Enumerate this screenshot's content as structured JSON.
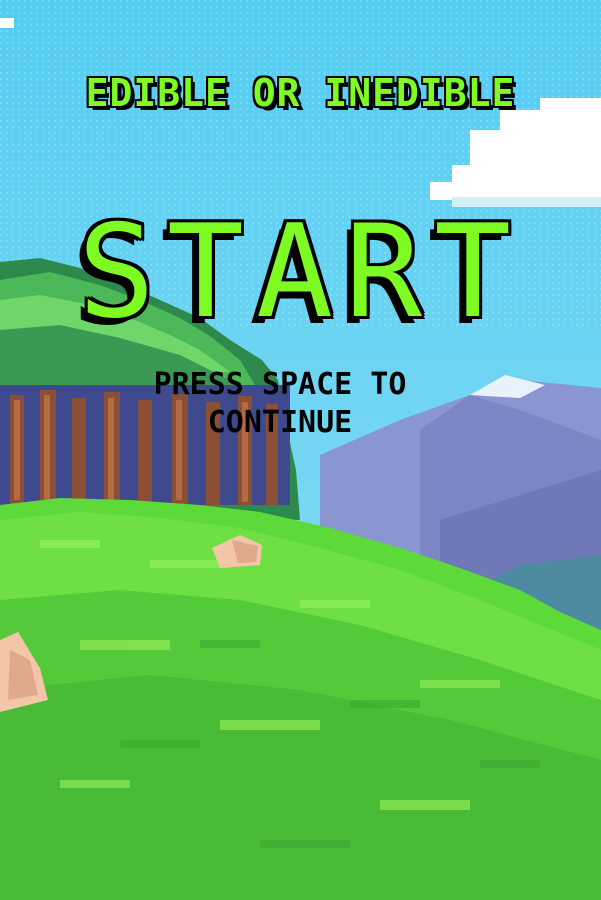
{
  "game": {
    "title": "EDIBLE OR INEDIBLE",
    "start_label": "START",
    "instruction": "PRESS SPACE TO CONTINUE"
  },
  "colors": {
    "title_fill": "#7dfb22",
    "outline": "#000000",
    "sky": "#5ccff2",
    "grass": "#5ed93a"
  }
}
